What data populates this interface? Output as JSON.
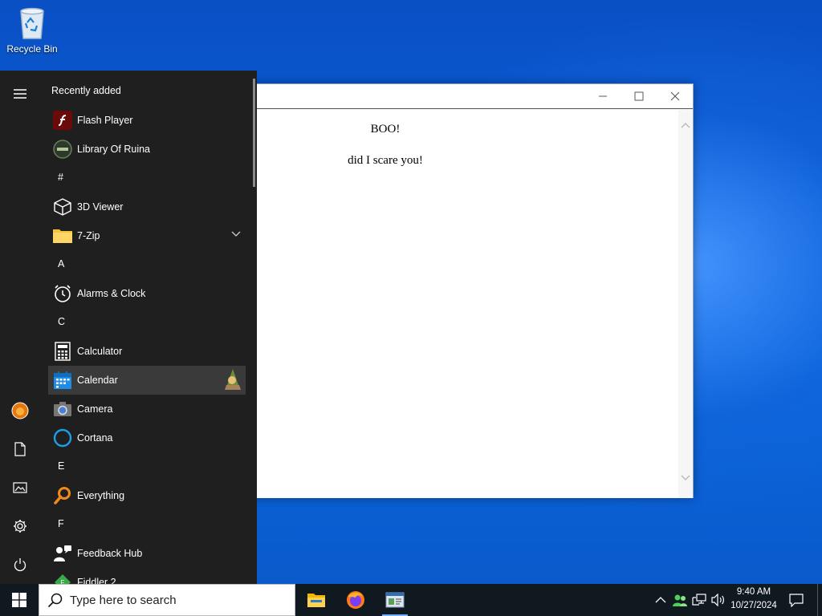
{
  "desktop": {
    "icons": [
      {
        "label": "Recycle Bin",
        "icon": "recycle-bin-icon"
      }
    ]
  },
  "app_window": {
    "content": {
      "heading": "BOO!",
      "body": "did I scare you!"
    },
    "controls": {
      "minimize": "minimize-icon",
      "maximize": "maximize-icon",
      "close": "close-icon"
    }
  },
  "start_menu": {
    "heading": "Recently added",
    "rail": [
      {
        "name": "hamburger-menu-icon"
      },
      {
        "name": "user-avatar"
      },
      {
        "name": "documents-icon"
      },
      {
        "name": "pictures-icon"
      },
      {
        "name": "settings-gear-icon"
      },
      {
        "name": "power-icon"
      }
    ],
    "recent": [
      {
        "label": "Flash Player",
        "icon": "flash-player-icon"
      },
      {
        "label": "Library Of Ruina",
        "icon": "library-of-ruina-icon"
      }
    ],
    "groups": [
      {
        "letter": "#",
        "items": [
          {
            "label": "3D Viewer",
            "icon": "3d-viewer-icon"
          },
          {
            "label": "7-Zip",
            "icon": "folder-icon",
            "expandable": true
          }
        ]
      },
      {
        "letter": "A",
        "items": [
          {
            "label": "Alarms & Clock",
            "icon": "alarm-clock-icon"
          }
        ]
      },
      {
        "letter": "C",
        "items": [
          {
            "label": "Calculator",
            "icon": "calculator-icon"
          },
          {
            "label": "Calendar",
            "icon": "calendar-icon",
            "highlighted": true
          },
          {
            "label": "Camera",
            "icon": "camera-icon"
          },
          {
            "label": "Cortana",
            "icon": "cortana-icon"
          }
        ]
      },
      {
        "letter": "E",
        "items": [
          {
            "label": "Everything",
            "icon": "everything-search-icon"
          }
        ]
      },
      {
        "letter": "F",
        "items": [
          {
            "label": "Feedback Hub",
            "icon": "feedback-hub-icon"
          },
          {
            "label": "Fiddler 2",
            "icon": "fiddler-icon"
          }
        ]
      }
    ]
  },
  "taskbar": {
    "search_placeholder": "Type here to search",
    "pinned": [
      {
        "name": "file-explorer-icon"
      },
      {
        "name": "firefox-icon"
      },
      {
        "name": "app-window-icon",
        "active": true
      }
    ],
    "tray": [
      {
        "name": "chevron-up-icon"
      },
      {
        "name": "people-icon"
      },
      {
        "name": "network-icon"
      },
      {
        "name": "volume-icon"
      }
    ],
    "time": "9:40 AM",
    "date": "10/27/2024"
  },
  "colors": {
    "accent": "#0a5fd8",
    "start_menu_bg": "#1f1f1f",
    "taskbar_bg": "#101820",
    "highlight": "#3a3a3a"
  }
}
